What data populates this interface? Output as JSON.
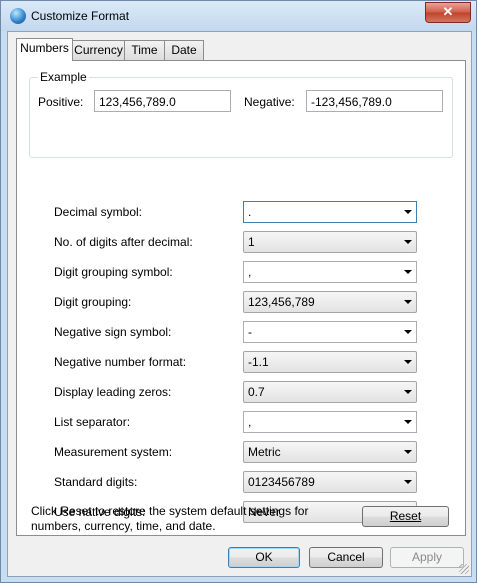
{
  "window": {
    "title": "Customize Format",
    "close_symbol": "✕"
  },
  "tabs": [
    "Numbers",
    "Currency",
    "Time",
    "Date"
  ],
  "example": {
    "group_title": "Example",
    "positive_label": "Positive:",
    "positive_value": "123,456,789.0",
    "negative_label": "Negative:",
    "negative_value": "-123,456,789.0"
  },
  "settings": [
    {
      "label": "Decimal symbol:",
      "value": ".",
      "kind": "edit",
      "focused": true
    },
    {
      "label": "No. of digits after decimal:",
      "value": "1",
      "kind": "list"
    },
    {
      "label": "Digit grouping symbol:",
      "value": ",",
      "kind": "edit"
    },
    {
      "label": "Digit grouping:",
      "value": "123,456,789",
      "kind": "list"
    },
    {
      "label": "Negative sign symbol:",
      "value": "-",
      "kind": "edit"
    },
    {
      "label": "Negative number format:",
      "value": "-1.1",
      "kind": "list"
    },
    {
      "label": "Display leading zeros:",
      "value": "0.7",
      "kind": "list"
    },
    {
      "label": "List separator:",
      "value": ",",
      "kind": "edit"
    },
    {
      "label": "Measurement system:",
      "value": "Metric",
      "kind": "list"
    },
    {
      "label": "Standard digits:",
      "value": "0123456789",
      "kind": "list"
    },
    {
      "label": "Use native digits:",
      "value": "Never",
      "kind": "list"
    }
  ],
  "help_text": "Click Reset to restore the system default settings for numbers, currency, time, and date.",
  "buttons": {
    "reset": "Reset",
    "ok": "OK",
    "cancel": "Cancel",
    "apply": "Apply"
  },
  "icons": {
    "app": "globe-icon",
    "dropdown": "chevron-down-icon"
  }
}
